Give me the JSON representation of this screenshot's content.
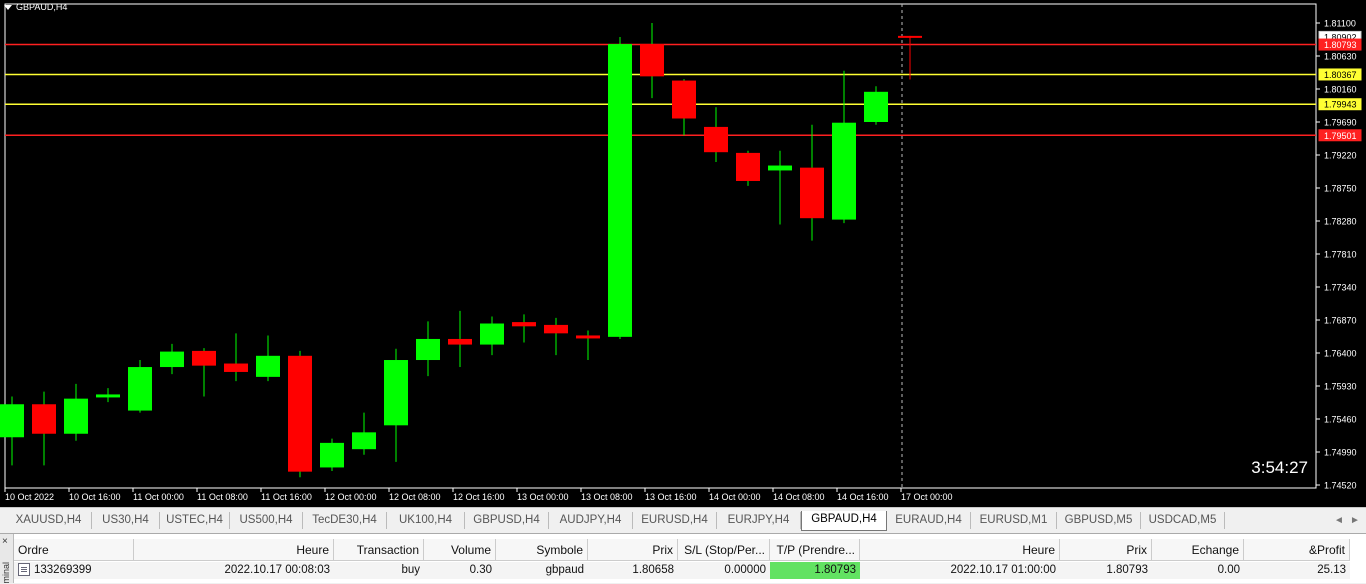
{
  "chart": {
    "symbol_label": "GBPAUD,H4",
    "countdown": "3:54:27",
    "price_axis": [
      "1.81100",
      "1.80630",
      "1.80160",
      "1.79690",
      "1.79220",
      "1.78750",
      "1.78280",
      "1.77810",
      "1.77340",
      "1.76870",
      "1.76400",
      "1.75930",
      "1.75460",
      "1.74990",
      "1.74520"
    ],
    "time_axis": [
      "10 Oct 2022",
      "10 Oct 16:00",
      "11 Oct 00:00",
      "11 Oct 08:00",
      "11 Oct 16:00",
      "12 Oct 00:00",
      "12 Oct 08:00",
      "12 Oct 16:00",
      "13 Oct 00:00",
      "13 Oct 08:00",
      "13 Oct 16:00",
      "14 Oct 00:00",
      "14 Oct 08:00",
      "14 Oct 16:00",
      "17 Oct 00:00"
    ],
    "hlines": [
      {
        "price": 1.80793,
        "color": "#ff2020",
        "label": "1.80793"
      },
      {
        "price": 1.80367,
        "color": "#ffff33",
        "label": "1.80367"
      },
      {
        "price": 1.79943,
        "color": "#ffff33",
        "label": "1.79943"
      },
      {
        "price": 1.79501,
        "color": "#ff2020",
        "label": "1.79501"
      }
    ],
    "bid_label": "1.80902",
    "colors": {
      "bull": "#00ff00",
      "bear": "#ff0000",
      "wick": "#00ff00"
    }
  },
  "chart_data": {
    "type": "candlestick",
    "symbol": "GBPAUD,H4",
    "ylim": [
      1.7452,
      1.8135
    ],
    "candles": [
      {
        "o": 1.752,
        "h": 1.7578,
        "l": 1.748,
        "c": 1.7567
      },
      {
        "o": 1.7567,
        "h": 1.7585,
        "l": 1.748,
        "c": 1.7525
      },
      {
        "o": 1.7525,
        "h": 1.7596,
        "l": 1.7515,
        "c": 1.7575
      },
      {
        "o": 1.7577,
        "h": 1.759,
        "l": 1.757,
        "c": 1.7581
      },
      {
        "o": 1.7558,
        "h": 1.763,
        "l": 1.7555,
        "c": 1.762
      },
      {
        "o": 1.762,
        "h": 1.7653,
        "l": 1.761,
        "c": 1.7642
      },
      {
        "o": 1.7643,
        "h": 1.7647,
        "l": 1.7578,
        "c": 1.7622
      },
      {
        "o": 1.7625,
        "h": 1.7668,
        "l": 1.76,
        "c": 1.7613
      },
      {
        "o": 1.7606,
        "h": 1.7665,
        "l": 1.76,
        "c": 1.7636
      },
      {
        "o": 1.7636,
        "h": 1.7643,
        "l": 1.7463,
        "c": 1.7471
      },
      {
        "o": 1.7477,
        "h": 1.7518,
        "l": 1.7472,
        "c": 1.7512
      },
      {
        "o": 1.7503,
        "h": 1.7555,
        "l": 1.7495,
        "c": 1.7527
      },
      {
        "o": 1.7537,
        "h": 1.7646,
        "l": 1.7485,
        "c": 1.763
      },
      {
        "o": 1.763,
        "h": 1.7685,
        "l": 1.7607,
        "c": 1.766
      },
      {
        "o": 1.766,
        "h": 1.77,
        "l": 1.762,
        "c": 1.7652
      },
      {
        "o": 1.7652,
        "h": 1.7692,
        "l": 1.7637,
        "c": 1.7682
      },
      {
        "o": 1.7684,
        "h": 1.7695,
        "l": 1.7655,
        "c": 1.7678
      },
      {
        "o": 1.768,
        "h": 1.769,
        "l": 1.7637,
        "c": 1.7668
      },
      {
        "o": 1.7665,
        "h": 1.7672,
        "l": 1.763,
        "c": 1.7663
      },
      {
        "o": 1.7663,
        "h": 1.809,
        "l": 1.766,
        "c": 1.808
      },
      {
        "o": 1.808,
        "h": 1.811,
        "l": 1.8003,
        "c": 1.8034
      },
      {
        "o": 1.8028,
        "h": 1.803,
        "l": 1.795,
        "c": 1.7974
      },
      {
        "o": 1.7962,
        "h": 1.799,
        "l": 1.7912,
        "c": 1.7926
      },
      {
        "o": 1.7925,
        "h": 1.7928,
        "l": 1.7878,
        "c": 1.7885
      },
      {
        "o": 1.79,
        "h": 1.7928,
        "l": 1.7823,
        "c": 1.7907
      },
      {
        "o": 1.7904,
        "h": 1.7965,
        "l": 1.78,
        "c": 1.7832
      },
      {
        "o": 1.783,
        "h": 1.8042,
        "l": 1.7825,
        "c": 1.7968
      },
      {
        "o": 1.7969,
        "h": 1.802,
        "l": 1.7965,
        "c": 1.8012
      },
      {
        "o": 1.80902,
        "h": 1.80902,
        "l": 1.80367,
        "c": 1.80902
      }
    ]
  },
  "tabs": [
    "XAUUSD,H4",
    "US30,H4",
    "USTEC,H4",
    "US500,H4",
    "TecDE30,H4",
    "UK100,H4",
    "GBPUSD,H4",
    "AUDJPY,H4",
    "EURUSD,H4",
    "EURJPY,H4",
    "GBPAUD,H4",
    "EURAUD,H4",
    "EURUSD,M1",
    "GBPUSD,M5",
    "USDCAD,M5"
  ],
  "active_tab": "GBPAUD,H4",
  "terminal": {
    "side_close": "×",
    "side_label": "minal",
    "headers": [
      "Ordre",
      "Heure",
      "Transaction",
      "Volume",
      "Symbole",
      "Prix",
      "S/L (Stop/Per...",
      "T/P (Prendre...",
      "Heure",
      "Prix",
      "Echange",
      "&Profit"
    ],
    "row": [
      "133269399",
      "2022.10.17 00:08:03",
      "buy",
      "0.30",
      "gbpaud",
      "1.80658",
      "0.00000",
      "1.80793",
      "2022.10.17 01:00:00",
      "1.80793",
      "0.00",
      "25.13"
    ]
  }
}
